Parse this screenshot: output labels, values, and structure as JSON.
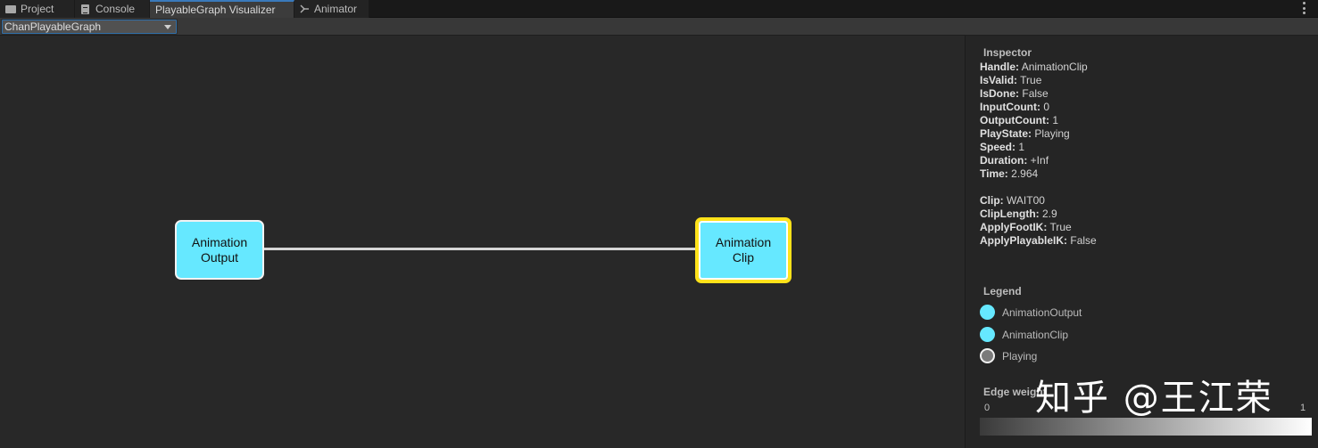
{
  "tabs": [
    {
      "label": "Project",
      "icon": "folder-icon"
    },
    {
      "label": "Console",
      "icon": "console-icon"
    },
    {
      "label": "PlayableGraph Visualizer",
      "icon": ""
    },
    {
      "label": "Animator",
      "icon": "animator-icon"
    }
  ],
  "toolbar": {
    "graph_select": "ChanPlayableGraph"
  },
  "graph": {
    "nodes": [
      {
        "label": "Animation\nOutput",
        "type": "AnimationOutput",
        "selected": false
      },
      {
        "label": "Animation\nClip",
        "type": "AnimationClip",
        "selected": true
      }
    ],
    "edge": {
      "from": "AnimationOutput",
      "to": "AnimationClip"
    },
    "colors": {
      "node": "#66e8ff",
      "selection": "#ffe21a",
      "edge": "#d6d6d6"
    }
  },
  "inspector": {
    "title": "Inspector",
    "props": [
      {
        "k": "Handle:",
        "v": "AnimationClip"
      },
      {
        "k": "IsValid:",
        "v": "True"
      },
      {
        "k": "IsDone:",
        "v": "False"
      },
      {
        "k": "InputCount:",
        "v": "0"
      },
      {
        "k": "OutputCount:",
        "v": "1"
      },
      {
        "k": "PlayState:",
        "v": "Playing"
      },
      {
        "k": "Speed:",
        "v": "1"
      },
      {
        "k": "Duration:",
        "v": "+Inf"
      },
      {
        "k": "Time:",
        "v": "2.964"
      }
    ],
    "clip_props": [
      {
        "k": "Clip:",
        "v": "WAIT00"
      },
      {
        "k": "ClipLength:",
        "v": "2.9"
      },
      {
        "k": "ApplyFootIK:",
        "v": "True"
      },
      {
        "k": "ApplyPlayableIK:",
        "v": "False"
      }
    ]
  },
  "legend": {
    "title": "Legend",
    "items": [
      {
        "label": "AnimationOutput",
        "color": "#66e8ff"
      },
      {
        "label": "AnimationClip",
        "color": "#66e8ff"
      },
      {
        "label": "Playing",
        "color": "#7a7a7a"
      }
    ]
  },
  "edge_weight": {
    "title": "Edge weight",
    "min": "0",
    "max": "1"
  },
  "watermark": "知乎 @王江荣"
}
